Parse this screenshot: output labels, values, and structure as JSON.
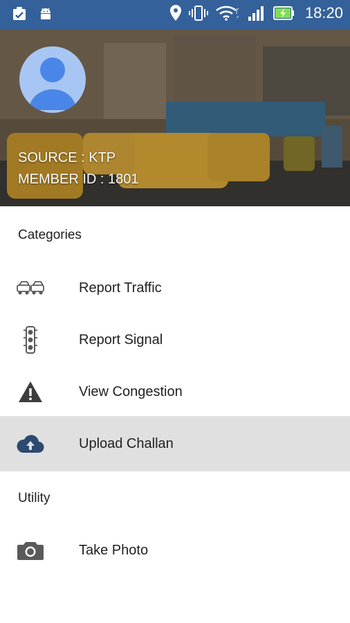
{
  "status_bar": {
    "time": "18:20",
    "icons": [
      "clipboard-icon",
      "android-icon",
      "location-icon",
      "vibrate-icon",
      "wifi-icon",
      "signal-icon",
      "battery-charging-icon"
    ]
  },
  "header": {
    "source": "SOURCE : KTP",
    "member_id": "MEMBER ID : 1801"
  },
  "drawer": {
    "categories_title": "Categories",
    "items": [
      {
        "label": "Report Traffic",
        "icon": "traffic-cars-icon"
      },
      {
        "label": "Report Signal",
        "icon": "traffic-light-icon"
      },
      {
        "label": "View Congestion",
        "icon": "warning-icon"
      },
      {
        "label": "Upload Challan",
        "icon": "cloud-upload-icon",
        "selected": true
      }
    ],
    "utility_title": "Utility",
    "utility_items": [
      {
        "label": "Take Photo",
        "icon": "camera-icon"
      }
    ]
  },
  "colors": {
    "status_bar": "#35619a",
    "selected_row": "#e0e0e0",
    "icon_dark": "#3d3d3d",
    "cloud_icon": "#2c4a70",
    "avatar_bg": "#a8c6f3",
    "avatar_fg": "#4a86e8"
  }
}
